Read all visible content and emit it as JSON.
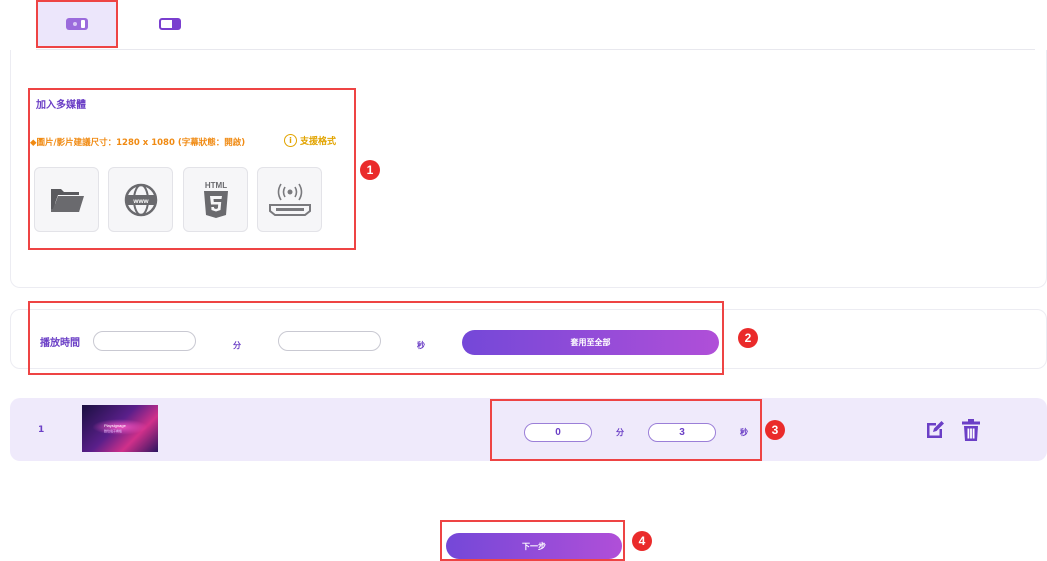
{
  "layout_tabs": [
    {
      "name": "layout-full",
      "selected": true
    },
    {
      "name": "layout-split",
      "selected": false
    }
  ],
  "media": {
    "title": "加入多媒體",
    "hint": "◆圖片/影片建議尺寸：1280 x 1080 (字幕狀態：開啟)",
    "support_label": "支援格式",
    "sources": [
      {
        "icon": "folder-icon"
      },
      {
        "icon": "web-url-icon"
      },
      {
        "icon": "html5-icon"
      },
      {
        "icon": "hdmi-stream-icon"
      }
    ]
  },
  "playtime": {
    "label": "播放時間",
    "minutes_value": "",
    "seconds_value": "",
    "minutes_unit": "分",
    "seconds_unit": "秒",
    "apply_all_label": "套用至全部"
  },
  "items": [
    {
      "index": "1",
      "thumbnail_text": "Playsignage",
      "thumbnail_subtext": "數位電子看板",
      "minutes": "0",
      "seconds": "3",
      "minutes_unit": "分",
      "seconds_unit": "秒"
    }
  ],
  "next_label": "下一步",
  "markers": [
    "1",
    "2",
    "3",
    "4"
  ],
  "colors": {
    "accent": "#6b3fc6",
    "hint": "#f08a12",
    "marker": "#ea2b2b",
    "row_bg": "#efeafb"
  }
}
